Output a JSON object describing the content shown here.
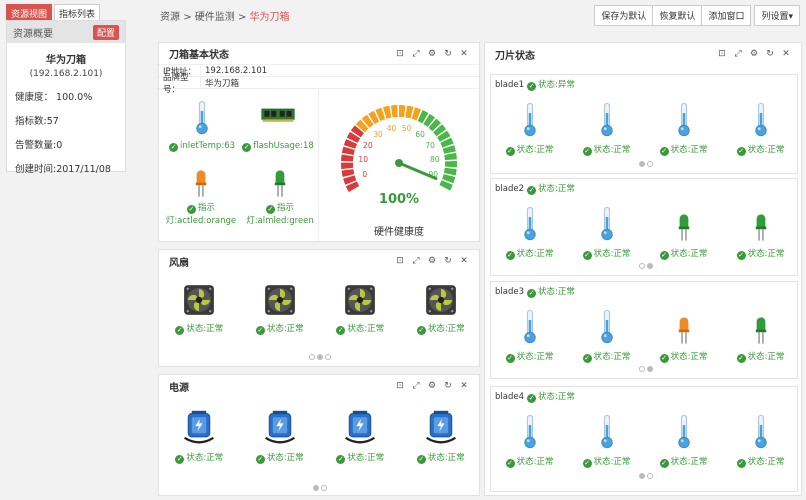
{
  "top_tabs": [
    "资源视图",
    "指标列表"
  ],
  "left_panel": {
    "title": "资源概要",
    "config_label": "配置",
    "name": "华为刀箱",
    "ip": "(192.168.2.101)",
    "health": "健康度： 100.0%",
    "metrics": "指标数:57",
    "alerts": "告警数量:0",
    "created": "创建时间:2017/11/08"
  },
  "breadcrumb": {
    "a": "资源",
    "b": "硬件监测",
    "sep": ">",
    "current": "华为刀箱"
  },
  "toolbar": {
    "save_default": "保存为默认",
    "restore_default": "恢复默认",
    "add_window": "添加窗口",
    "col_settings": "列设置▾"
  },
  "box_panel": {
    "title": "刀箱基本状态",
    "ip_key": "IP地址：",
    "ip_val": "192.168.2.101",
    "model_key": "品牌型号：",
    "model_val": "华为刀箱",
    "inlet": "inletTemp:63",
    "flash": "flashUsage:18",
    "actled_a": "指示",
    "actled_b": "灯:actled:orange",
    "almled_a": "指示",
    "almled_b": "灯:almled:green",
    "gauge_value": "100%",
    "gauge_label": "硬件健康度",
    "gauge_ticks": [
      "0",
      "10",
      "20",
      "30",
      "40",
      "50",
      "60",
      "70",
      "80",
      "90"
    ],
    "gauge_level": 0.97
  },
  "fan_panel": {
    "title": "风扇",
    "status": [
      "状态:正常",
      "状态:正常",
      "状态:正常",
      "状态:正常"
    ]
  },
  "power_panel": {
    "title": "电源",
    "status": [
      "状态:正常",
      "状态:正常",
      "状态:正常",
      "状态:正常"
    ]
  },
  "blade_panel": {
    "title": "刀片状态"
  },
  "blades": [
    {
      "name": "blade1",
      "state": "状态:异常",
      "items": [
        "状态:正常",
        "状态:正常",
        "状态:正常",
        "状态:正常"
      ]
    },
    {
      "name": "blade2",
      "state": "状态:正常",
      "items": [
        "状态:正常",
        "状态:正常",
        "状态:正常",
        "状态:正常"
      ]
    },
    {
      "name": "blade3",
      "state": "状态:正常",
      "items": [
        "状态:正常",
        "状态:正常",
        "状态:正常",
        "状态:正常"
      ]
    },
    {
      "name": "blade4",
      "state": "状态:正常",
      "items": [
        "状态:正常",
        "状态:正常",
        "状态:正常",
        "状态:正常"
      ]
    }
  ],
  "colors": {
    "accent_red": "#d9534f",
    "ok_green": "#3a9a3a",
    "therm_blue": "#4aa3df",
    "led_orange": "#f08a24",
    "led_green": "#2f9e3a"
  }
}
